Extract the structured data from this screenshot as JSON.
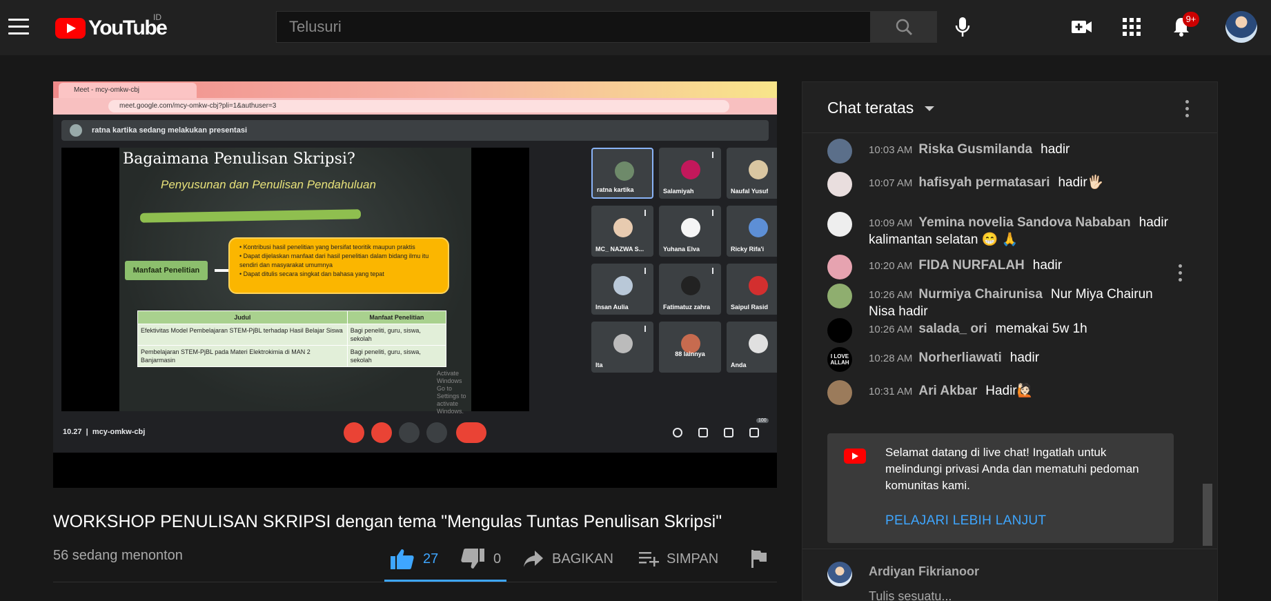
{
  "header": {
    "logo_text": "YouTube",
    "country_code": "ID",
    "search_placeholder": "Telusuri",
    "notification_badge": "9+"
  },
  "player": {
    "tab_title": "Meet - mcy-omkw-cbj",
    "url": "meet.google.com/mcy-omkw-cbj?pli=1&authuser=3",
    "presenting_banner": "ratna kartika sedang melakukan presentasi",
    "slide": {
      "title": "Bagaimana Penulisan Skripsi?",
      "subtitle": "Penyusunan dan Penulisan Pendahuluan",
      "label": "Manfaat Penelitian",
      "bullets": [
        "Kontribusi hasil penelitian yang bersifat teoritik maupun praktis",
        "Dapat dijelaskan manfaat dari hasil penelitian dalam bidang ilmu itu sendiri dan masyarakat umumnya",
        "Dapat ditulis secara singkat dan bahasa yang tepat"
      ],
      "table_headers": [
        "Judul",
        "Manfaat Penelitian"
      ],
      "table_rows": [
        [
          "Efektivitas Model Pembelajaran STEM-PjBL terhadap Hasil Belajar Siswa",
          "Bagi peneliti, guru, siswa, sekolah"
        ],
        [
          "Pembelajaran STEM-PjBL pada Materi Elektrokimia di MAN 2 Banjarmasin",
          "Bagi peneliti, guru, siswa, sekolah"
        ]
      ],
      "watermark_line1": "Activate Windows",
      "watermark_line2": "Go to Settings to activate Windows."
    },
    "participants": [
      {
        "name": "ratna kartika",
        "color": "#6e8a6a"
      },
      {
        "name": "Salamiyah",
        "color": "#c2185b"
      },
      {
        "name": "Naufal Yusuf",
        "color": "#d9c6a1"
      },
      {
        "name": "MC_ NAZWA S...",
        "color": "#e8cbb0"
      },
      {
        "name": "Yuhana Elva",
        "color": "#f5f5f5"
      },
      {
        "name": "Ricky Rifa'i",
        "color": "#5d8fd6"
      },
      {
        "name": "Insan Aulia",
        "color": "#b9c8d8"
      },
      {
        "name": "Fatimatuz zahra",
        "color": "#222222"
      },
      {
        "name": "Saipul Rasid",
        "color": "#d32f2f"
      },
      {
        "name": "Ita",
        "color": "#bbbbbb"
      },
      {
        "name": "88 lainnya",
        "color": "#c76b4f"
      },
      {
        "name": "Anda",
        "color": "#e0e0e0"
      }
    ],
    "meeting_time": "10.27",
    "meeting_code": "mcy-omkw-cbj",
    "participant_count": "100"
  },
  "video": {
    "title": "WORKSHOP PENULISAN SKRIPSI dengan tema \"Mengulas Tuntas Penulisan Skripsi\"",
    "view_count": "56 sedang menonton",
    "like_count": "27",
    "dislike_count": "0",
    "share_label": "BAGIKAN",
    "save_label": "SIMPAN"
  },
  "chat": {
    "title": "Chat teratas",
    "messages": [
      {
        "time": "10:03 AM",
        "author": "Riska Gusmilanda",
        "text": "hadir",
        "avatar_color": "#5b6f8a"
      },
      {
        "time": "10:07 AM",
        "author": "hafisyah permatasari",
        "text": "hadir🖐🏻",
        "avatar_color": "#e9dede"
      },
      {
        "time": "10:09 AM",
        "author": "Yemina novelia Sandova Nababan",
        "text": "hadir kalimantan selatan 😁 🙏",
        "avatar_color": "#eeeeee"
      },
      {
        "time": "10:20 AM",
        "author": "FIDA NURFALAH",
        "text": "hadir",
        "avatar_color": "#e6a3b0"
      },
      {
        "time": "10:26 AM",
        "author": "Nurmiya Chairunisa",
        "text": "Nur Miya Chairun Nisa hadir",
        "avatar_color": "#8fae6f"
      },
      {
        "time": "10:26 AM",
        "author": "salada_ ori",
        "text": "memakai 5w 1h",
        "avatar_color": "#000000"
      },
      {
        "time": "10:28 AM",
        "author": "Norherliawati",
        "text": "hadir",
        "avatar_color": "#000000",
        "avatar_text": "I LOVE ALLAH"
      },
      {
        "time": "10:31 AM",
        "author": "Ari Akbar",
        "text": "Hadir🙋🏻",
        "avatar_color": "#9b7b5b"
      }
    ],
    "welcome_text": "Selamat datang di live chat! Ingatlah untuk melindungi privasi Anda dan mematuhi pedoman komunitas kami.",
    "welcome_link": "PELAJARI LEBIH LANJUT",
    "user_name": "Ardiyan Fikrianoor",
    "input_placeholder": "Tulis sesuatu..."
  }
}
